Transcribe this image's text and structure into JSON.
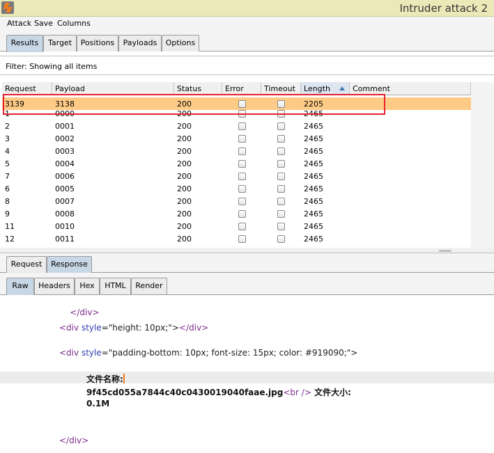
{
  "window": {
    "title": "Intruder attack 2"
  },
  "menu": [
    "Attack",
    "Save",
    "Columns"
  ],
  "top_tabs": [
    {
      "label": "Results",
      "active": true
    },
    {
      "label": "Target",
      "active": false
    },
    {
      "label": "Positions",
      "active": false
    },
    {
      "label": "Payloads",
      "active": false
    },
    {
      "label": "Options",
      "active": false
    }
  ],
  "filter": {
    "text": "Filter:  Showing all items"
  },
  "table": {
    "columns": [
      "Request",
      "Payload",
      "Status",
      "Error",
      "Timeout",
      "Length",
      "Comment"
    ],
    "sorted_column": "Length",
    "rows": [
      {
        "request": "3139",
        "payload": "3138",
        "status": "200",
        "error": false,
        "timeout": false,
        "length": "2205",
        "comment": "",
        "selected": true
      },
      {
        "request": "1",
        "payload": "0000",
        "status": "200",
        "error": false,
        "timeout": false,
        "length": "2465",
        "comment": ""
      },
      {
        "request": "2",
        "payload": "0001",
        "status": "200",
        "error": false,
        "timeout": false,
        "length": "2465",
        "comment": ""
      },
      {
        "request": "3",
        "payload": "0002",
        "status": "200",
        "error": false,
        "timeout": false,
        "length": "2465",
        "comment": ""
      },
      {
        "request": "4",
        "payload": "0003",
        "status": "200",
        "error": false,
        "timeout": false,
        "length": "2465",
        "comment": ""
      },
      {
        "request": "5",
        "payload": "0004",
        "status": "200",
        "error": false,
        "timeout": false,
        "length": "2465",
        "comment": ""
      },
      {
        "request": "7",
        "payload": "0006",
        "status": "200",
        "error": false,
        "timeout": false,
        "length": "2465",
        "comment": ""
      },
      {
        "request": "6",
        "payload": "0005",
        "status": "200",
        "error": false,
        "timeout": false,
        "length": "2465",
        "comment": ""
      },
      {
        "request": "8",
        "payload": "0007",
        "status": "200",
        "error": false,
        "timeout": false,
        "length": "2465",
        "comment": ""
      },
      {
        "request": "9",
        "payload": "0008",
        "status": "200",
        "error": false,
        "timeout": false,
        "length": "2465",
        "comment": ""
      },
      {
        "request": "11",
        "payload": "0010",
        "status": "200",
        "error": false,
        "timeout": false,
        "length": "2465",
        "comment": ""
      },
      {
        "request": "12",
        "payload": "0011",
        "status": "200",
        "error": false,
        "timeout": false,
        "length": "2465",
        "comment": ""
      }
    ]
  },
  "mid_tabs": [
    {
      "label": "Request",
      "active": false
    },
    {
      "label": "Response",
      "active": true
    }
  ],
  "view_tabs": [
    {
      "label": "Raw",
      "active": true
    },
    {
      "label": "Headers",
      "active": false
    },
    {
      "label": "Hex",
      "active": false
    },
    {
      "label": "HTML",
      "active": false
    },
    {
      "label": "Render",
      "active": false
    }
  ],
  "response_code": {
    "line1": "</div>",
    "line2_open": "<div",
    "line2_attr": "style",
    "line2_val": "=\"height: 10px;\">",
    "line2_close": "</div>",
    "line3_open": "<div",
    "line3_attr": "style",
    "line3_val": "=\"padding-bottom: 10px; font-size: 15px; color: #919090;\">",
    "filename_label": "文件名称:",
    "filename": "9f45cd055a7844c40c0430019040faae.jpg",
    "br_tag": "<br />",
    "size_label": " 文件大小:",
    "size_value": "0.1M",
    "line_last": "</div>"
  },
  "accent_colors": {
    "selected_row": "#fecb87",
    "highlight_border": "#e4202e",
    "active_tab": "#c8d7e6"
  }
}
